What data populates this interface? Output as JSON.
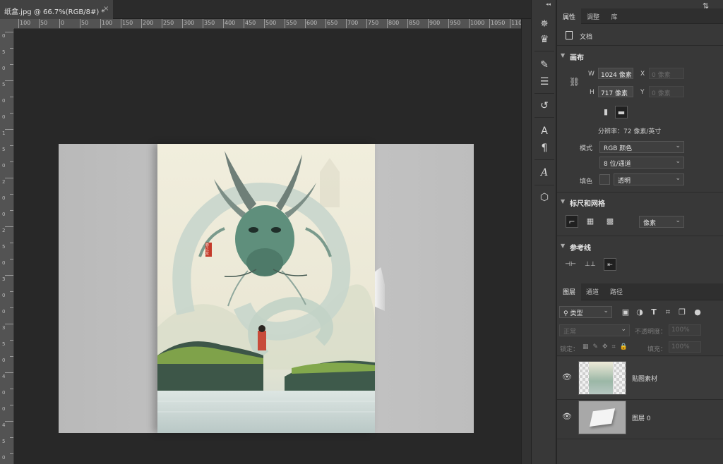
{
  "document": {
    "tab_title": "纸盒.jpg @ 66.7%(RGB/8#) *",
    "close_glyph": "×"
  },
  "ruler": {
    "top_labels": [
      "100",
      "50",
      "0",
      "50",
      "100",
      "150",
      "200",
      "250",
      "300",
      "350",
      "400",
      "450",
      "500",
      "550",
      "600",
      "650",
      "700",
      "750",
      "800",
      "850",
      "900",
      "950",
      "1000",
      "1050",
      "1100"
    ],
    "left_labels": [
      "0",
      "5",
      "0",
      "5",
      "0",
      "0",
      "1",
      "5",
      "0",
      "2",
      "0",
      "0",
      "2",
      "5",
      "0",
      "3",
      "0",
      "0",
      "3",
      "5",
      "0",
      "4",
      "0",
      "0",
      "4",
      "5",
      "0"
    ]
  },
  "poster": {
    "seal_text": "春之龙"
  },
  "toolbar": {
    "collapse_glyph": "◂◂",
    "icons": [
      "compass-icon",
      "crown-icon",
      "brush-settings-icon",
      "adjust-sliders-icon",
      "history-icon",
      "character-icon",
      "paragraph-icon",
      "glyphs-icon",
      "3d-cube-icon"
    ]
  },
  "panel": {
    "tabs": [
      "属性",
      "调整",
      "库"
    ],
    "doc_label": "文档",
    "canvas_section": {
      "title": "画布",
      "w_label": "W",
      "w_value": "1024 像素",
      "h_label": "H",
      "h_value": "717 像素",
      "x_label": "X",
      "x_value": "0 像素",
      "y_label": "Y",
      "y_value": "0 像素",
      "resolution": "分辨率：72 像素/英寸",
      "mode_label": "模式",
      "mode_value": "RGB 颜色",
      "depth_value": "8 位/通道",
      "fill_label": "填色",
      "fill_value": "透明"
    },
    "rulers_section": {
      "title": "标尺和网格",
      "unit_value": "像素"
    },
    "guides_section": {
      "title": "参考线"
    }
  },
  "layers_panel": {
    "tabs": [
      "图层",
      "通道",
      "路径"
    ],
    "filter_label": "类型",
    "blend_mode": "正常",
    "opacity_label": "不透明度：",
    "opacity_value": "100%",
    "lock_label": "锁定：",
    "fill_label": "填充：",
    "fill_value": "100%",
    "layers": [
      {
        "name": "贴图素材",
        "visible": true
      },
      {
        "name": "图层 0",
        "visible": true
      }
    ]
  },
  "colors": {
    "panel_bg": "#383838",
    "canvas_bg": "#282828",
    "ruler_bg": "#535353",
    "mockup_bg": "#c0c0c0",
    "seal_red": "#c43a2a",
    "dragon_green": "#5f8f7c"
  }
}
